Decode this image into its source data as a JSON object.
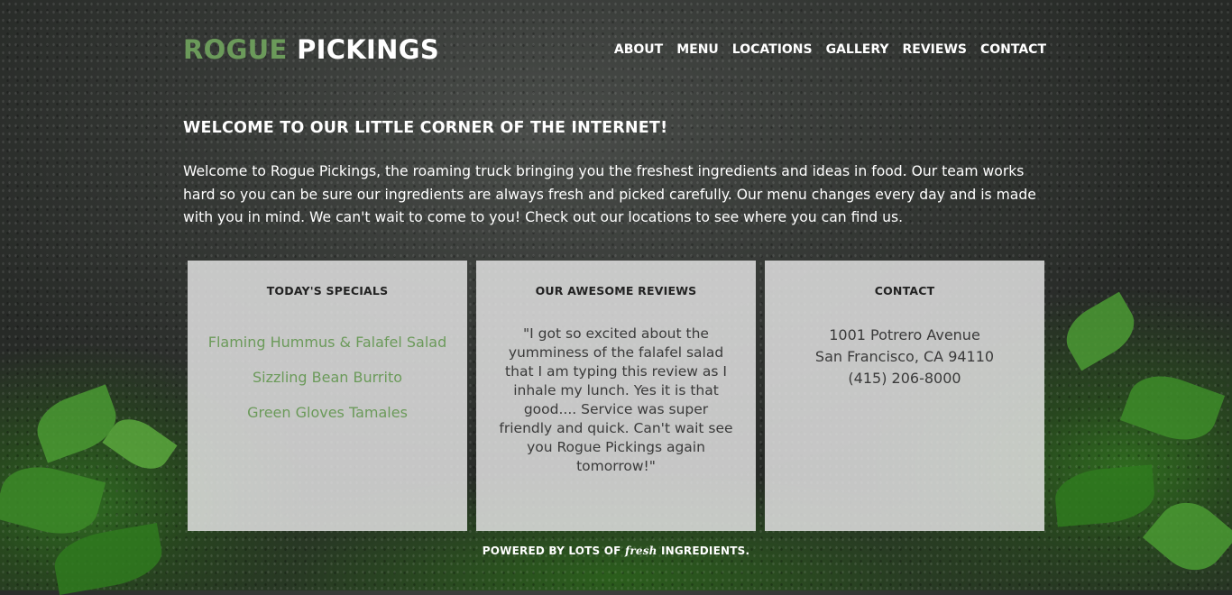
{
  "brand": {
    "part1": "ROGUE",
    "part2": "PICKINGS",
    "accent_color": "#6b9a5a"
  },
  "nav": [
    "ABOUT",
    "MENU",
    "LOCATIONS",
    "GALLERY",
    "REVIEWS",
    "CONTACT"
  ],
  "welcome": {
    "heading": "WELCOME TO OUR LITTLE CORNER OF THE INTERNET!",
    "body": "Welcome to Rogue Pickings, the roaming truck bringing you the freshest ingredients and ideas in food. Our team works hard so you can be sure our ingredients are always fresh and picked carefully. Our menu changes every day and is made with you in mind. We can't wait to come to you! Check out our locations to see where you can find us."
  },
  "specials": {
    "title": "TODAY'S SPECIALS",
    "items": [
      "Flaming Hummus & Falafel Salad",
      "Sizzling Bean Burrito",
      "Green Gloves Tamales"
    ]
  },
  "reviews": {
    "title": "OUR AWESOME REVIEWS",
    "quote": "\"I got so excited about the yumminess of the falafel salad that I am typing this review as I inhale my lunch. Yes it is that good.... Service was super friendly and quick. Can't wait see you Rogue Pickings again tomorrow!\""
  },
  "contact": {
    "title": "CONTACT",
    "street": "1001 Potrero Avenue",
    "city": "San Francisco, CA 94110",
    "phone": "(415) 206-8000"
  },
  "footer": {
    "before": "POWERED BY LOTS OF",
    "script": "fresh",
    "after": "INGREDIENTS."
  }
}
